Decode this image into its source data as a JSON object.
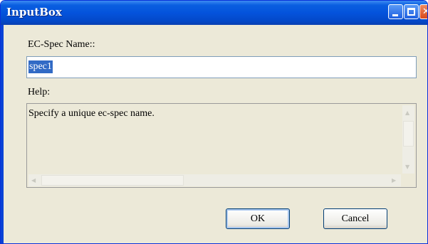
{
  "window": {
    "title": "InputBox",
    "controls": {
      "minimize_icon": "minimize-icon",
      "maximize_icon": "maximize-icon",
      "close_icon": "close-icon",
      "close_glyph": "✕"
    },
    "colors": {
      "titlebar": "#0453dc",
      "face": "#ece9d8",
      "selection": "#316ac5"
    }
  },
  "form": {
    "name_label": "EC-Spec Name::",
    "name_value": "spec1",
    "help_label": "Help:",
    "help_text": "Specify a unique ec-spec name."
  },
  "scrollbars": {
    "up_arrow": "▲",
    "down_arrow": "▼",
    "left_arrow": "◀",
    "right_arrow": "▶"
  },
  "buttons": {
    "ok_label": "OK",
    "cancel_label": "Cancel"
  }
}
